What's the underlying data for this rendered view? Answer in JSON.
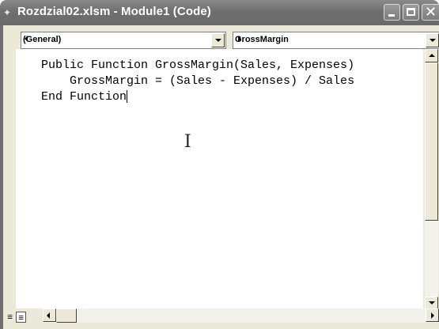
{
  "window": {
    "title": "Rozdzial02.xlsm - Module1 (Code)",
    "icon": "vba-module-icon"
  },
  "toolbar": {
    "object_combo": "(General)",
    "procedure_combo": "GrossMargin"
  },
  "code": {
    "line1": "Public Function GrossMargin(Sales, Expenses)",
    "line2": "    GrossMargin = (Sales - Expenses) / Sales",
    "line3": "End Function"
  }
}
